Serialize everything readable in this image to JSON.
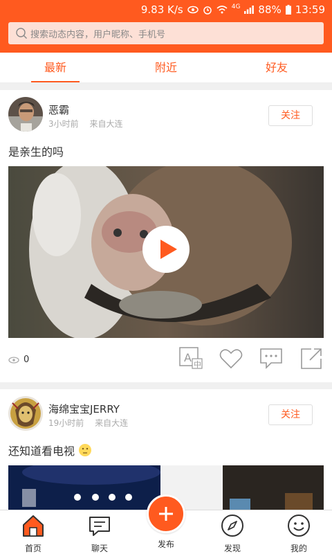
{
  "status_bar": {
    "speed": "9.83 K/s",
    "network": "4G",
    "battery": "88%",
    "time": "13:59"
  },
  "search": {
    "placeholder": "搜索动态内容，用户昵称、手机号"
  },
  "tabs": [
    {
      "label": "最新",
      "active": true
    },
    {
      "label": "附近",
      "active": false
    },
    {
      "label": "好友",
      "active": false
    }
  ],
  "posts": [
    {
      "username": "恶霸",
      "time": "3小时前",
      "location": "来自大连",
      "follow_label": "关注",
      "text": "是亲生的吗",
      "views": "0"
    },
    {
      "username": "海绵宝宝JERRY",
      "time": "19小时前",
      "location": "来自大连",
      "follow_label": "关注",
      "text": "还知道看电视"
    }
  ],
  "bottom_nav": {
    "home": "首页",
    "chat": "聊天",
    "publish": "发布",
    "discover": "发现",
    "mine": "我的"
  },
  "colors": {
    "accent": "#ff5a1f"
  }
}
